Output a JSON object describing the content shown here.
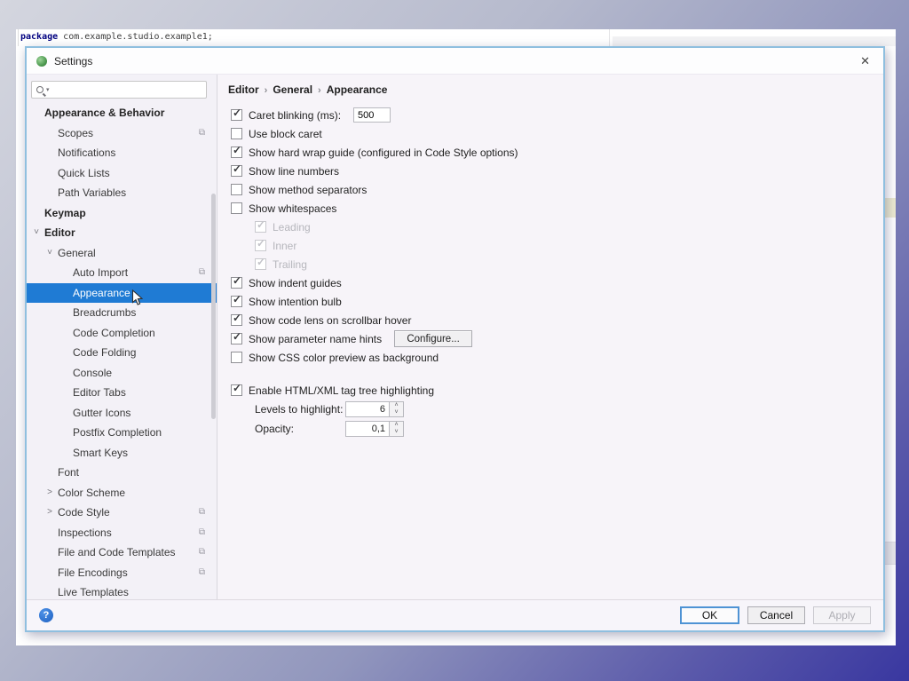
{
  "icons": {
    "close": "✕",
    "check": "✓",
    "chevron_down": "˅",
    "chevron_right": "˃",
    "breadcrumb_separator": "›",
    "settings_badge": "⧉",
    "search_dropdown": "▾",
    "help": "?",
    "spin_up": "˄",
    "spin_down": "˅"
  },
  "colors": {
    "selection_blue": "#1f7bd4",
    "dialog_border": "#8fbfdf",
    "help_blue": "#1d5fc0",
    "slide_gradient_start": "#d4d6df",
    "slide_gradient_end": "#3937a0"
  },
  "editor": {
    "code_keyword": "package",
    "code_rest": " com.example.studio.example1;"
  },
  "dialog": {
    "title": "Settings",
    "search_placeholder": "",
    "breadcrumb": [
      "Editor",
      "General",
      "Appearance"
    ],
    "sidebar": [
      {
        "label": "Appearance & Behavior",
        "level": 1,
        "bold": true
      },
      {
        "label": "Scopes",
        "level": 2,
        "icon": true
      },
      {
        "label": "Notifications",
        "level": 2
      },
      {
        "label": "Quick Lists",
        "level": 2
      },
      {
        "label": "Path Variables",
        "level": 2
      },
      {
        "label": "Keymap",
        "level": 1,
        "bold": true
      },
      {
        "label": "Editor",
        "level": 1,
        "bold": true,
        "chevron": "down"
      },
      {
        "label": "General",
        "level": 2,
        "chevron": "down"
      },
      {
        "label": "Auto Import",
        "level": 3,
        "icon": true
      },
      {
        "label": "Appearance",
        "level": 3,
        "selected": true,
        "cursor": true
      },
      {
        "label": "Breadcrumbs",
        "level": 3
      },
      {
        "label": "Code Completion",
        "level": 3
      },
      {
        "label": "Code Folding",
        "level": 3
      },
      {
        "label": "Console",
        "level": 3
      },
      {
        "label": "Editor Tabs",
        "level": 3
      },
      {
        "label": "Gutter Icons",
        "level": 3
      },
      {
        "label": "Postfix Completion",
        "level": 3
      },
      {
        "label": "Smart Keys",
        "level": 3
      },
      {
        "label": "Font",
        "level": 2
      },
      {
        "label": "Color Scheme",
        "level": 2,
        "chevron": "right"
      },
      {
        "label": "Code Style",
        "level": 2,
        "chevron": "right",
        "icon": true
      },
      {
        "label": "Inspections",
        "level": 2,
        "icon": true
      },
      {
        "label": "File and Code Templates",
        "level": 2,
        "icon": true
      },
      {
        "label": "File Encodings",
        "level": 2,
        "icon": true
      },
      {
        "label": "Live Templates",
        "level": 2
      }
    ],
    "options": [
      {
        "label": "Caret blinking (ms):",
        "checked": true,
        "control": {
          "type": "input",
          "value": "500"
        }
      },
      {
        "label": "Use block caret",
        "checked": false
      },
      {
        "label": "Show hard wrap guide (configured in Code Style options)",
        "checked": true
      },
      {
        "label": "Show line numbers",
        "checked": true
      },
      {
        "label": "Show method separators",
        "checked": false
      },
      {
        "label": "Show whitespaces",
        "checked": false
      },
      {
        "label": "Leading",
        "checked": true,
        "disabled": true,
        "sub": true
      },
      {
        "label": "Inner",
        "checked": true,
        "disabled": true,
        "sub": true
      },
      {
        "label": "Trailing",
        "checked": true,
        "disabled": true,
        "sub": true
      },
      {
        "label": "Show indent guides",
        "checked": true
      },
      {
        "label": "Show intention bulb",
        "checked": true
      },
      {
        "label": "Show code lens on scrollbar hover",
        "checked": true
      },
      {
        "label": "Show parameter name hints",
        "checked": true,
        "control": {
          "type": "button",
          "label": "Configure..."
        }
      },
      {
        "label": "Show CSS color preview as background",
        "checked": false
      }
    ],
    "tag_section": {
      "enable_label": "Enable HTML/XML tag tree highlighting",
      "enable_checked": true,
      "levels_label": "Levels to highlight:",
      "levels_value": "6",
      "opacity_label": "Opacity:",
      "opacity_value": "0,1"
    },
    "footer": {
      "ok": "OK",
      "cancel": "Cancel",
      "apply": "Apply"
    }
  }
}
